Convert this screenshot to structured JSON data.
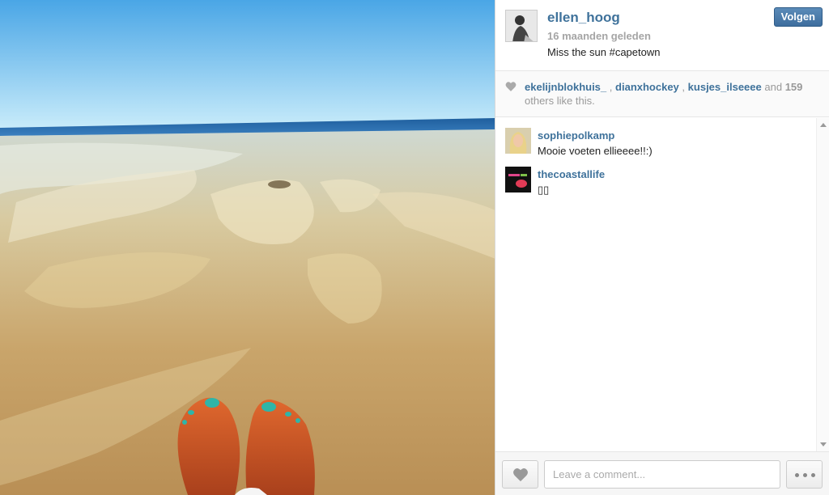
{
  "post": {
    "username": "ellen_hoog",
    "time_ago": "16 maanden geleden",
    "caption": "Miss the sun #capetown",
    "follow_label": "Volgen",
    "photo_icon": "beach-feet-photo"
  },
  "likes": {
    "users": [
      "ekelijnblokhuis_",
      "dianxhockey",
      "kusjes_ilseeee"
    ],
    "sep": ",",
    "and": "and",
    "count": "159",
    "others": "others like this."
  },
  "comments": [
    {
      "username": "sophiepolkamp",
      "text": "Mooie voeten ellieeee!!:)"
    },
    {
      "username": "thecoastallife",
      "text": "▯▯"
    }
  ],
  "footer": {
    "placeholder": "Leave a comment...",
    "like_icon": "heart-icon",
    "more_icon": "more-dots-icon"
  },
  "colors": {
    "link": "#3f729b",
    "muted": "#a5a5a5",
    "follow_button": "#3e6e9e"
  }
}
